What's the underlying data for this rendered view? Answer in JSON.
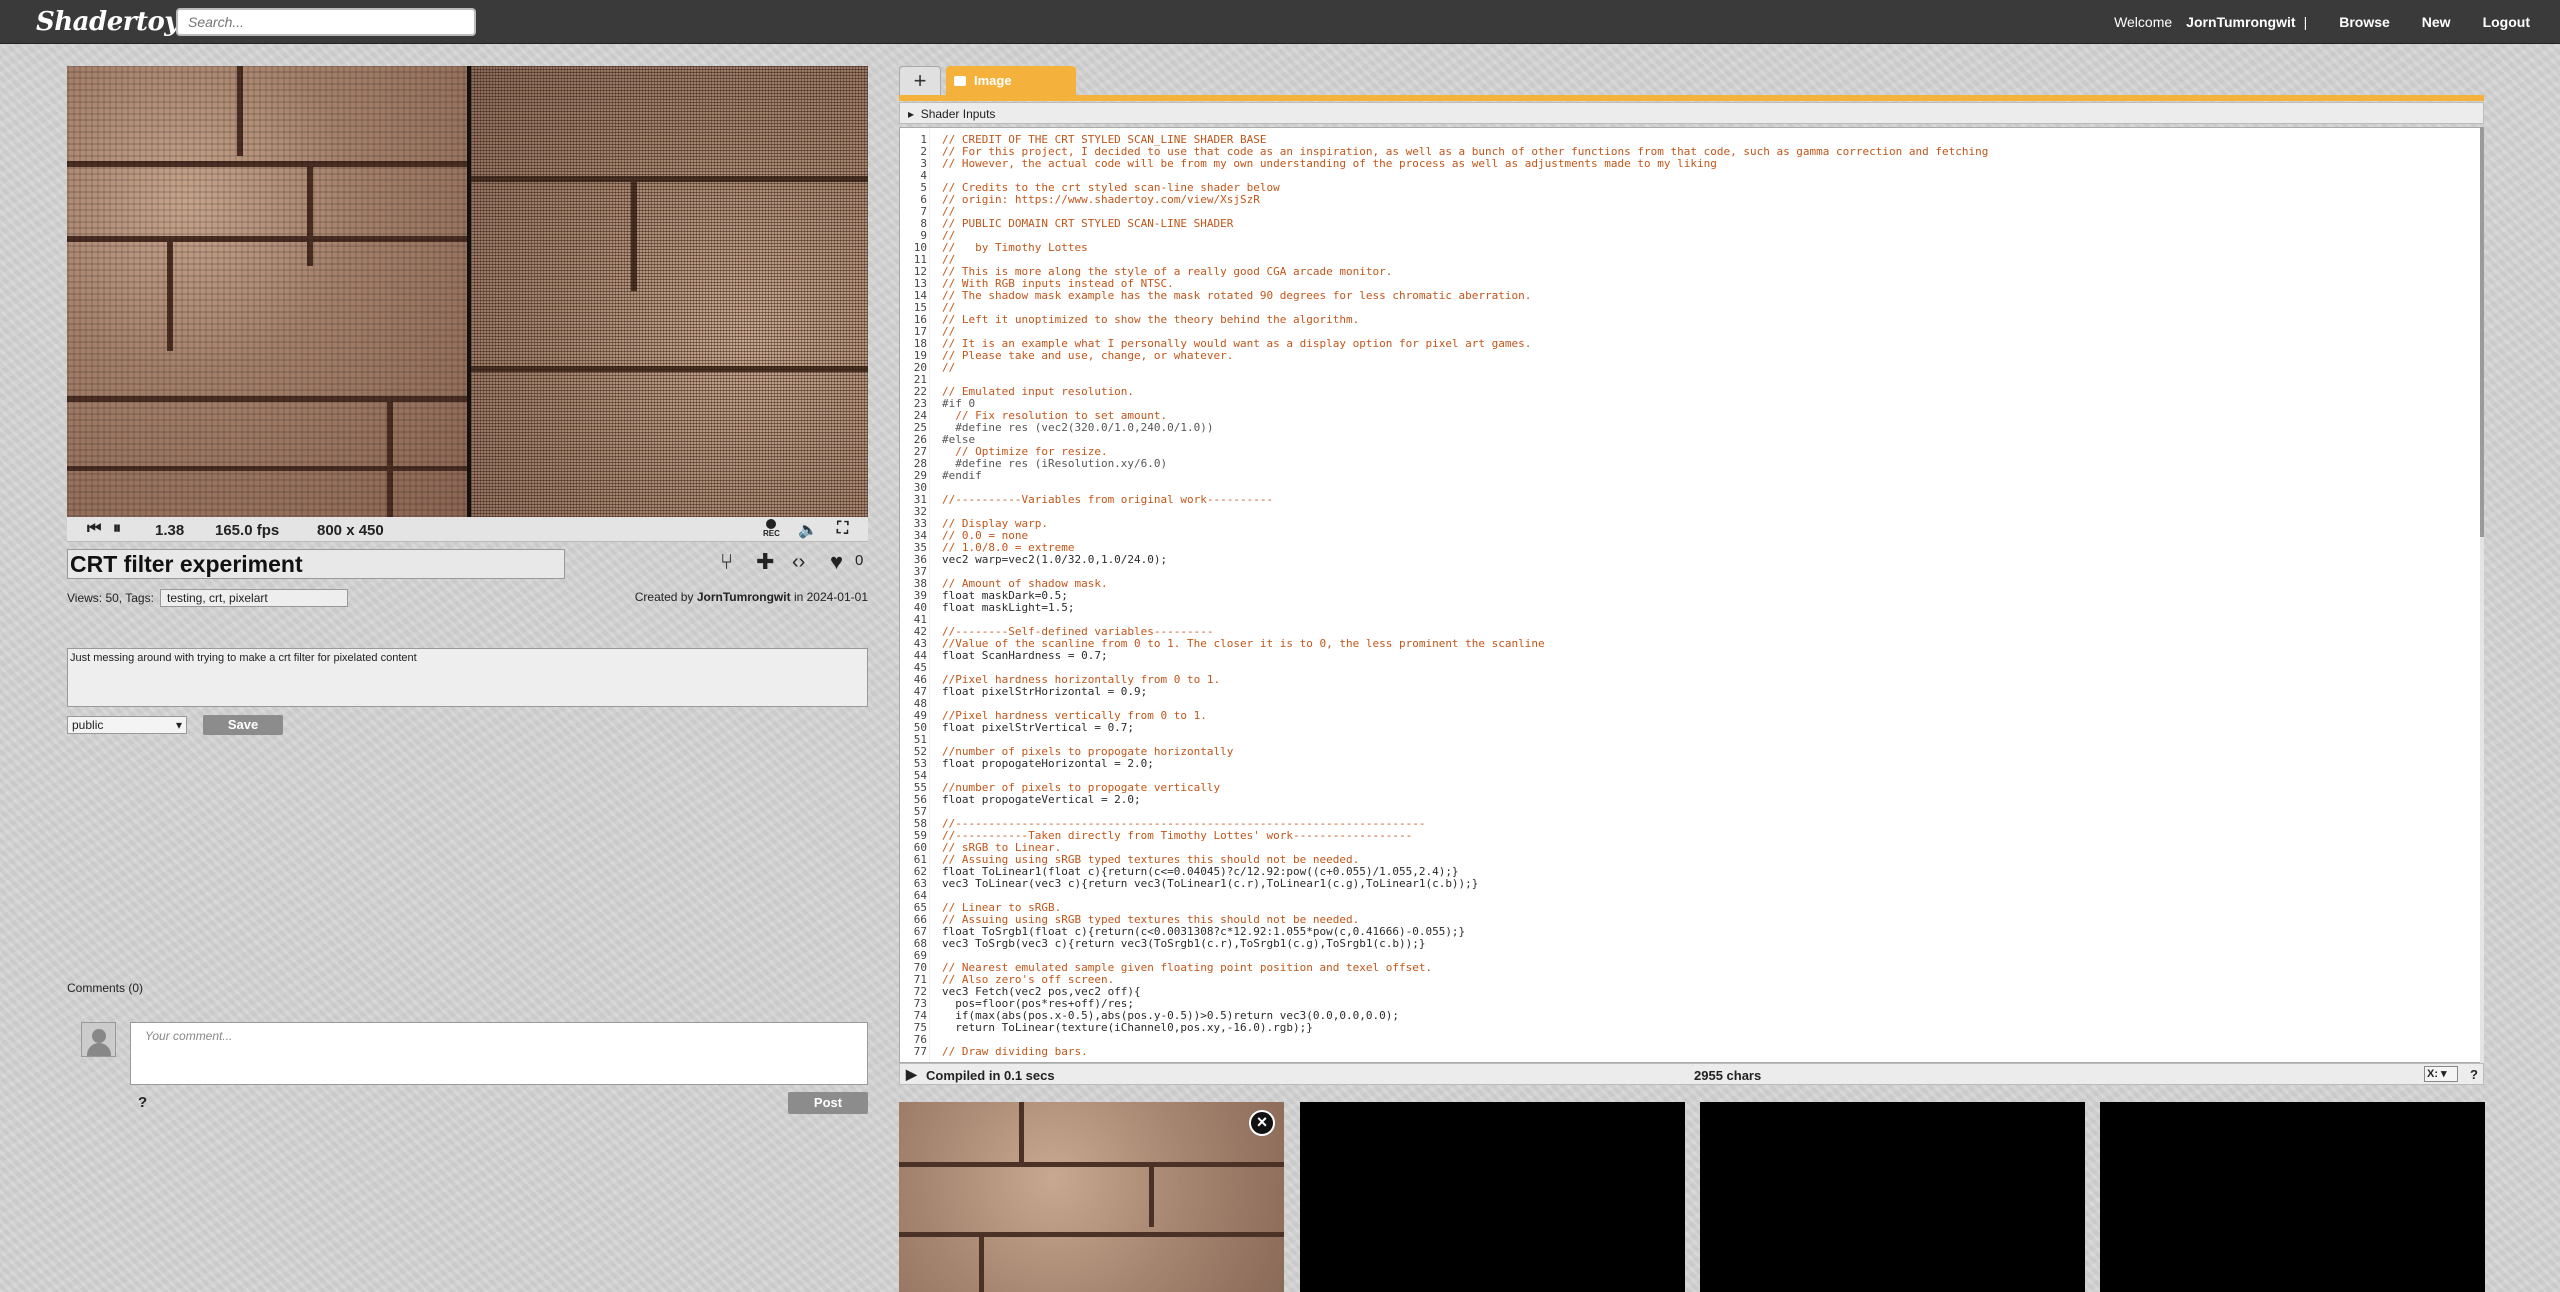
{
  "header": {
    "logo": "Shadertoy",
    "search_placeholder": "Search...",
    "welcome": "Welcome",
    "username": "JornTumrongwit",
    "separator": "|",
    "browse": "Browse",
    "new": "New",
    "logout": "Logout"
  },
  "player": {
    "time": "1.38",
    "fps": "165.0 fps",
    "resolution": "800 x 450",
    "rec_label": "REC"
  },
  "shader": {
    "title": "CRT filter experiment",
    "likes": "0",
    "views": "Views: 50, Tags:",
    "tags": "testing, crt, pixelart",
    "created_by": "Created by",
    "author": "JornTumrongwit",
    "created_in": "in 2024-01-01",
    "description": "Just messing around with trying to make a crt filter for pixelated content",
    "visibility": "public",
    "save": "Save"
  },
  "comments": {
    "header": "Comments (0)",
    "placeholder": "Your comment...",
    "help": "?",
    "post": "Post"
  },
  "editor": {
    "add_tab": "+",
    "tab_image": "Image",
    "shader_inputs": "Shader Inputs",
    "compiled": "Compiled in 0.1 secs",
    "chars": "2955 chars",
    "font_select": "X:",
    "help": "?",
    "lines": [
      "// CREDIT OF THE CRT STYLED SCAN_LINE SHADER BASE",
      "// For this project, I decided to use that code as an inspiration, as well as a bunch of other functions from that code, such as gamma correction and fetching",
      "// However, the actual code will be from my own understanding of the process as well as adjustments made to my liking",
      "",
      "// Credits to the crt styled scan-line shader below",
      "// origin: https://www.shadertoy.com/view/XsjSzR",
      "//",
      "// PUBLIC DOMAIN CRT STYLED SCAN-LINE SHADER",
      "//",
      "//   by Timothy Lottes",
      "//",
      "// This is more along the style of a really good CGA arcade monitor.",
      "// With RGB inputs instead of NTSC.",
      "// The shadow mask example has the mask rotated 90 degrees for less chromatic aberration.",
      "//",
      "// Left it unoptimized to show the theory behind the algorithm.",
      "//",
      "// It is an example what I personally would want as a display option for pixel art games.",
      "// Please take and use, change, or whatever.",
      "//",
      "",
      "// Emulated input resolution.",
      "#if 0",
      "  // Fix resolution to set amount.",
      "  #define res (vec2(320.0/1.0,240.0/1.0))",
      "#else",
      "  // Optimize for resize.",
      "  #define res (iResolution.xy/6.0)",
      "#endif",
      "",
      "//----------Variables from original work----------",
      "",
      "// Display warp.",
      "// 0.0 = none",
      "// 1.0/8.0 = extreme",
      "vec2 warp=vec2(1.0/32.0,1.0/24.0);",
      "",
      "// Amount of shadow mask.",
      "float maskDark=0.5;",
      "float maskLight=1.5;",
      "",
      "//--------Self-defined variables---------",
      "//Value of the scanline from 0 to 1. The closer it is to 0, the less prominent the scanline",
      "float ScanHardness = 0.7;",
      "",
      "//Pixel hardness horizontally from 0 to 1.",
      "float pixelStrHorizontal = 0.9;",
      "",
      "//Pixel hardness vertically from 0 to 1.",
      "float pixelStrVertical = 0.7;",
      "",
      "//number of pixels to propogate horizontally",
      "float propogateHorizontal = 2.0;",
      "",
      "//number of pixels to propogate vertically",
      "float propogateVertical = 2.0;",
      "",
      "//-----------------------------------------------------------------------",
      "//-----------Taken directly from Timothy Lottes' work------------------",
      "// sRGB to Linear.",
      "// Assuing using sRGB typed textures this should not be needed.",
      "float ToLinear1(float c){return(c<=0.04045)?c/12.92:pow((c+0.055)/1.055,2.4);}",
      "vec3 ToLinear(vec3 c){return vec3(ToLinear1(c.r),ToLinear1(c.g),ToLinear1(c.b));}",
      "",
      "// Linear to sRGB.",
      "// Assuing using sRGB typed textures this should not be needed.",
      "float ToSrgb1(float c){return(c<0.0031308?c*12.92:1.055*pow(c,0.41666)-0.055);}",
      "vec3 ToSrgb(vec3 c){return vec3(ToSrgb1(c.r),ToSrgb1(c.g),ToSrgb1(c.b));}",
      "",
      "// Nearest emulated sample given floating point position and texel offset.",
      "// Also zero's off screen.",
      "vec3 Fetch(vec2 pos,vec2 off){",
      "  pos=floor(pos*res+off)/res;",
      "  if(max(abs(pos.x-0.5),abs(pos.y-0.5))>0.5)return vec3(0.0,0.0,0.0);",
      "  return ToLinear(texture(iChannel0,pos.xy,-16.0).rgb);}",
      "",
      "// Draw dividing bars."
    ]
  }
}
